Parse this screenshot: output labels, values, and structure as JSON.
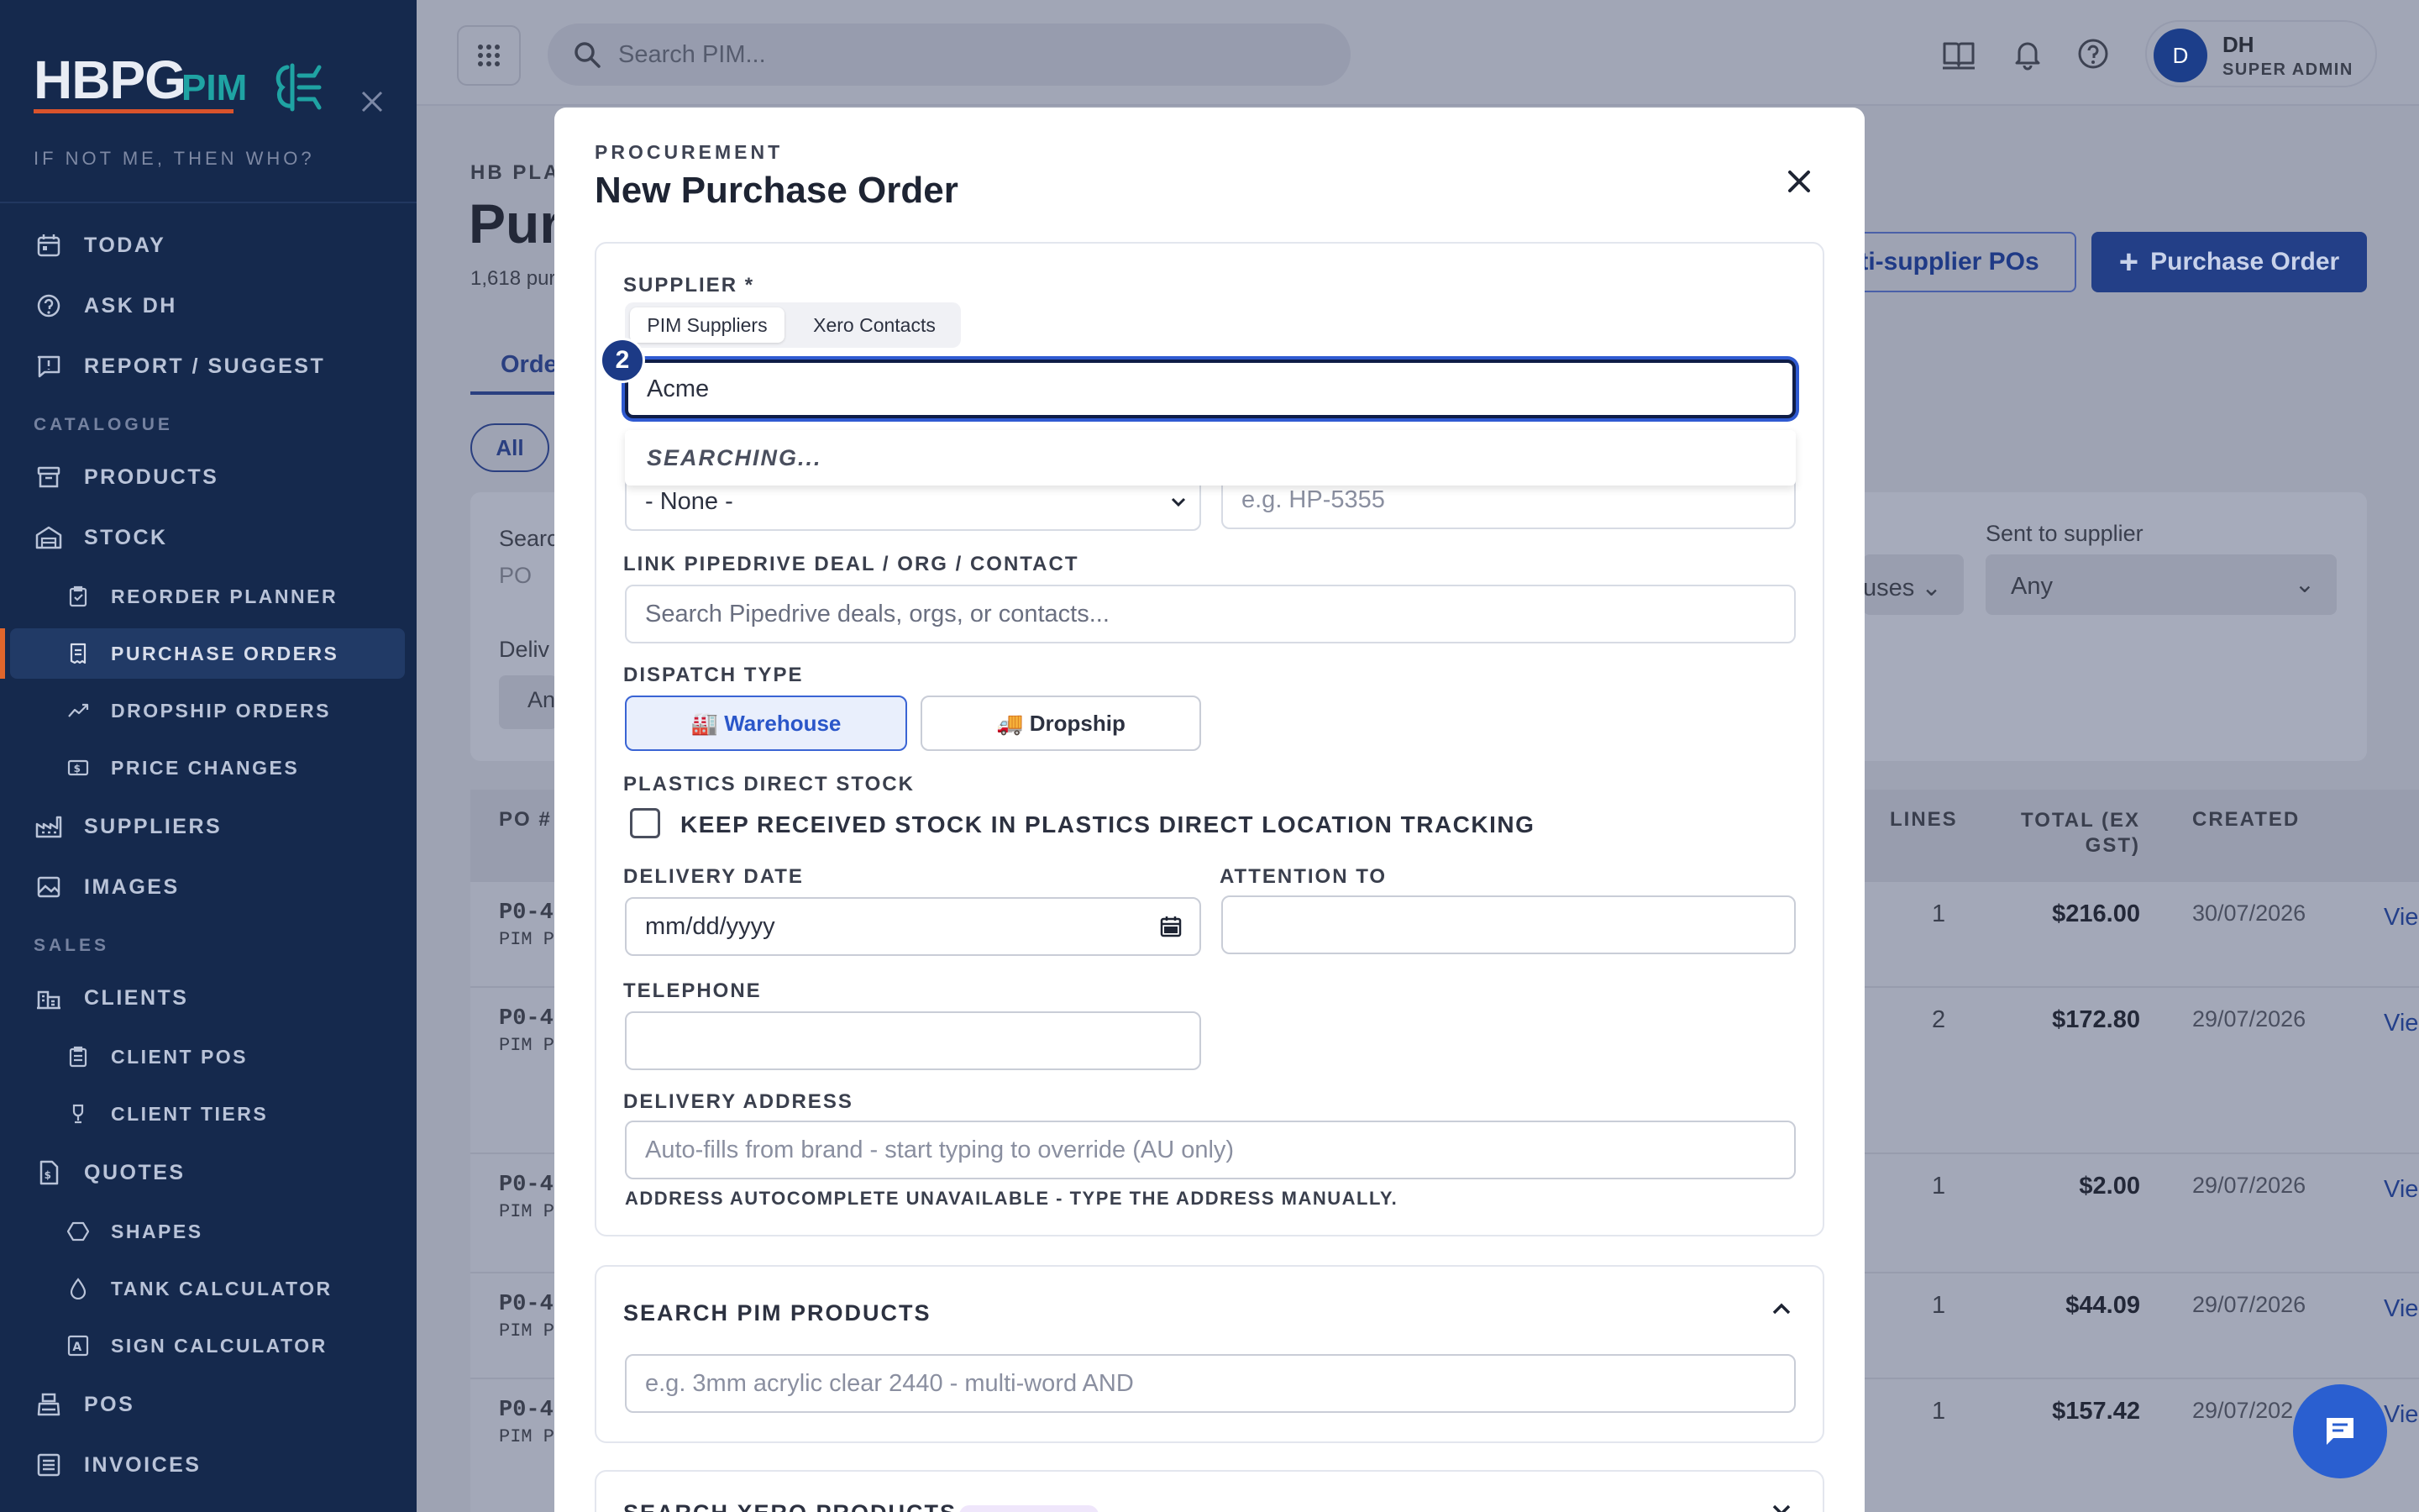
{
  "sidebar": {
    "logo_main": "HBPG",
    "logo_sub": "PIM",
    "tagline": "IF NOT ME, THEN WHO?",
    "items": [
      {
        "label": "TODAY",
        "icon": "calendar-icon"
      },
      {
        "label": "ASK DH",
        "icon": "help-circle-icon"
      },
      {
        "label": "REPORT / SUGGEST",
        "icon": "feedback-icon"
      },
      {
        "label": "PRODUCTS",
        "icon": "archive-icon"
      },
      {
        "label": "STOCK",
        "icon": "warehouse-icon"
      },
      {
        "label": "REORDER PLANNER",
        "icon": "clipboard-icon"
      },
      {
        "label": "PURCHASE ORDERS",
        "icon": "receipt-icon"
      },
      {
        "label": "DROPSHIP ORDERS",
        "icon": "trend-icon"
      },
      {
        "label": "PRICE CHANGES",
        "icon": "price-icon"
      },
      {
        "label": "SUPPLIERS",
        "icon": "factory-icon"
      },
      {
        "label": "IMAGES",
        "icon": "image-icon"
      },
      {
        "label": "CLIENTS",
        "icon": "building-icon"
      },
      {
        "label": "CLIENT POS",
        "icon": "clipboard-list-icon"
      },
      {
        "label": "CLIENT TIERS",
        "icon": "trophy-icon"
      },
      {
        "label": "QUOTES",
        "icon": "document-dollar-icon"
      },
      {
        "label": "SHAPES",
        "icon": "hexagon-icon"
      },
      {
        "label": "TANK CALCULATOR",
        "icon": "droplet-icon"
      },
      {
        "label": "SIGN CALCULATOR",
        "icon": "sign-icon"
      },
      {
        "label": "POS",
        "icon": "register-icon"
      },
      {
        "label": "INVOICES",
        "icon": "list-icon"
      }
    ],
    "sections": [
      "CATALOGUE",
      "SALES"
    ]
  },
  "topbar": {
    "search_placeholder": "Search PIM...",
    "user_initial": "D",
    "user_name": "DH",
    "user_role": "SUPER ADMIN"
  },
  "background": {
    "breadcrumb": "HB PLA",
    "title": "Pur",
    "count": "1,618 pur",
    "tab": "Orde",
    "filter_all": "All",
    "search_label": "Searc",
    "search_value": "PO",
    "delivery_label": "Deliv",
    "delivery_value": "An",
    "multi_btn": "lti-supplier POs",
    "po_btn": "Purchase Order",
    "status_value": "uses",
    "sent_label": "Sent to supplier",
    "sent_value": "Any",
    "columns": {
      "po": "PO #",
      "lines": "LINES",
      "total": "TOTAL (EX GST)",
      "created": "CREATED"
    },
    "rows": [
      {
        "po": "P0-4",
        "sub": "PIM P",
        "lines": "1",
        "total": "$216.00",
        "created": "30/07/2026",
        "view": "Vie"
      },
      {
        "po": "P0-4",
        "sub": "PIM P",
        "lines": "2",
        "total": "$172.80",
        "created": "29/07/2026",
        "view": "Vie"
      },
      {
        "po": "P0-4",
        "sub": "PIM P",
        "lines": "1",
        "total": "$2.00",
        "created": "29/07/2026",
        "view": "Vie"
      },
      {
        "po": "P0-4",
        "sub": "PIM P",
        "lines": "1",
        "total": "$44.09",
        "created": "29/07/2026",
        "view": "Vie"
      },
      {
        "po": "P0-4",
        "sub": "PIM P",
        "lines": "1",
        "total": "$157.42",
        "created": "29/07/202",
        "view": "Vie"
      }
    ]
  },
  "modal": {
    "eyebrow": "PROCUREMENT",
    "title": "New Purchase Order",
    "supplier_label": "SUPPLIER *",
    "tab_pim": "PIM Suppliers",
    "tab_xero": "Xero Contacts",
    "step_badge": "2",
    "supplier_value": "Acme",
    "searching": "SEARCHING...",
    "brand_select": "- None -",
    "ref_placeholder": "e.g. HP-5355",
    "pipedrive_label": "LINK PIPEDRIVE DEAL / ORG / CONTACT",
    "pipedrive_placeholder": "Search Pipedrive deals, orgs, or contacts...",
    "dispatch_label": "DISPATCH TYPE",
    "warehouse": "🏭 Warehouse",
    "dropship": "🚚 Dropship",
    "plastics_label": "PLASTICS DIRECT STOCK",
    "plastics_check": "KEEP RECEIVED STOCK IN PLASTICS DIRECT LOCATION TRACKING",
    "delivery_date_label": "DELIVERY DATE",
    "delivery_date_value": "mm/dd/yyyy",
    "attention_label": "ATTENTION TO",
    "telephone_label": "TELEPHONE",
    "address_label": "DELIVERY ADDRESS",
    "address_placeholder": "Auto-fills from brand  - start typing to override (AU only)",
    "address_hint": "ADDRESS AUTOCOMPLETE UNAVAILABLE - TYPE THE ADDRESS MANUALLY.",
    "search_pim_label": "SEARCH PIM PRODUCTS",
    "search_pim_placeholder": "e.g. 3mm acrylic clear 2440  - multi-word AND",
    "search_xero_label": "SEARCH XERO PRODUCTS"
  },
  "colors": {
    "sidebar": "#15294d",
    "accent": "#1c3a86",
    "brand_orange": "#d9532c",
    "brand_teal": "#1fa3a3"
  }
}
